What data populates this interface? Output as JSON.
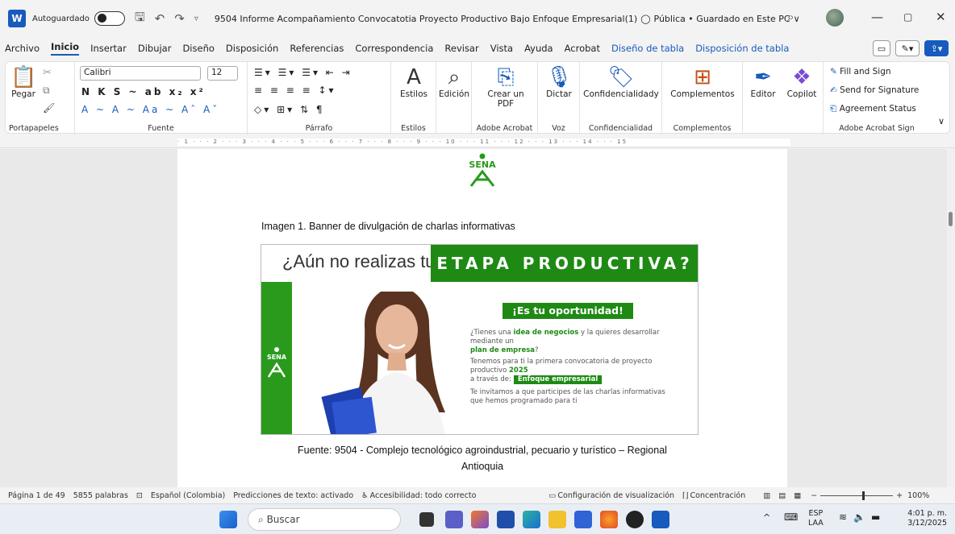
{
  "titlebar": {
    "autosave_label": "Autoguardado",
    "doc_title": "9504 Informe Acompañamiento Convocatotia Proyecto Productivo Bajo Enfoque Empresarial(1)",
    "sensitivity": "Pública • Guardado en Este PC",
    "chevron": "∨"
  },
  "menu": {
    "items": [
      "Archivo",
      "Inicio",
      "Insertar",
      "Dibujar",
      "Diseño",
      "Disposición",
      "Referencias",
      "Correspondencia",
      "Revisar",
      "Vista",
      "Ayuda",
      "Acrobat"
    ],
    "context_tabs": [
      "Diseño de tabla",
      "Disposición de tabla"
    ]
  },
  "ribbon": {
    "clipboard": {
      "paste_label": "Pegar",
      "group_label": "Portapapeles"
    },
    "font": {
      "font_name": "Calibri",
      "font_size": "12",
      "group_label": "Fuente",
      "row2": "N K S ~ ab x₂ x²",
      "row3": "A ~ A ~ Aa ~ Aˆ Aˇ"
    },
    "paragraph": {
      "group_label": "Párrafo"
    },
    "styles": {
      "label": "Estilos",
      "group_label": "Estilos"
    },
    "editing": {
      "label": "Edición"
    },
    "acrobat": {
      "label": "Crear un PDF",
      "group_label": "Adobe Acrobat"
    },
    "voice": {
      "label": "Dictar",
      "group_label": "Voz"
    },
    "sensitivity": {
      "label": "Confidencialidady",
      "group_label": "Confidencialidad"
    },
    "addins": {
      "label": "Complementos",
      "group_label": "Complementos"
    },
    "editor": {
      "label": "Editor"
    },
    "copilot": {
      "label": "Copilot"
    },
    "sign": {
      "items": [
        "Fill and Sign",
        "Send for Signature",
        "Agreement Status"
      ],
      "group_label": "Adobe Acrobat Sign"
    }
  },
  "ruler": {
    "text": "· 1 · · · 2 · · · 3 · · · 4 · · · 5 · · · 6 · · · 7 · · · 8 · · · 9 · · · 10 · · · 11 · · · 12 · · · 13 · · · 14 · · · 15"
  },
  "document": {
    "logo_text": "SENA",
    "caption": "Imagen 1. Banner de divulgación de charlas informativas",
    "banner": {
      "question": "¿Aún no realizas tu",
      "headline": "ETAPA PRODUCTIVA?",
      "badge": "¡Es tu oportunidad!",
      "p1_a": "¿Tienes una ",
      "p1_b": "idea de negocios",
      "p1_c": " y la quieres desarrollar mediante un",
      "p1_d": "plan de empresa",
      "p1_e": "?",
      "p2_a": "Tenemos para ti la primera convocatoria de proyecto productivo ",
      "p2_b": "2025",
      "p2_c": "a través de:",
      "p2_tag": "Enfoque empresarial",
      "p3": "Te invitamos a que participes de las charlas informativas que hemos programado para ti",
      "side_logo": "SENA"
    },
    "source_line1": "Fuente: 9504 - Complejo tecnológico agroindustrial, pecuario y turístico – Regional",
    "source_line2": "Antioquia"
  },
  "statusbar": {
    "page": "Página 1 de 49",
    "words": "5855 palabras",
    "language": "Español (Colombia)",
    "predictions": "Predicciones de texto: activado",
    "accessibility": "Accesibilidad: todo correcto",
    "display": "Configuración de visualización",
    "focus": "Concentración",
    "zoom": "100%"
  },
  "taskbar": {
    "search_placeholder": "Buscar",
    "lang1": "ESP",
    "lang2": "LAA",
    "time": "4:01 p. m.",
    "date": "3/12/2025"
  },
  "colors": {
    "accent": "#185abd",
    "sena_green": "#1e8a14"
  }
}
